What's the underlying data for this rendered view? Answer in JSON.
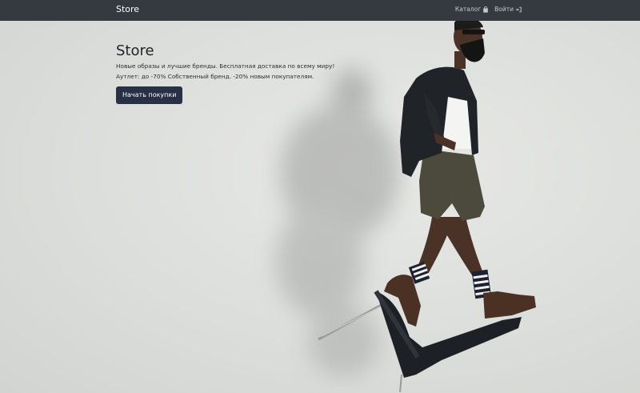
{
  "nav": {
    "brand": "Store",
    "links": [
      {
        "label": "Каталог",
        "icon": "shopping-bag-icon"
      },
      {
        "label": "Войти",
        "icon": "sign-in-icon"
      }
    ]
  },
  "hero": {
    "title": "Store",
    "line1": "Новые образы и лучшие бренды. Бесплатная доставка по всему миру!",
    "line2": "Аутлет: до -70% Собственный бренд. -20% новым покупателям.",
    "cta_label": "Начать покупки"
  },
  "colors": {
    "navbar": "#343a40",
    "cta": "#283045",
    "background": "#dcdedb"
  }
}
